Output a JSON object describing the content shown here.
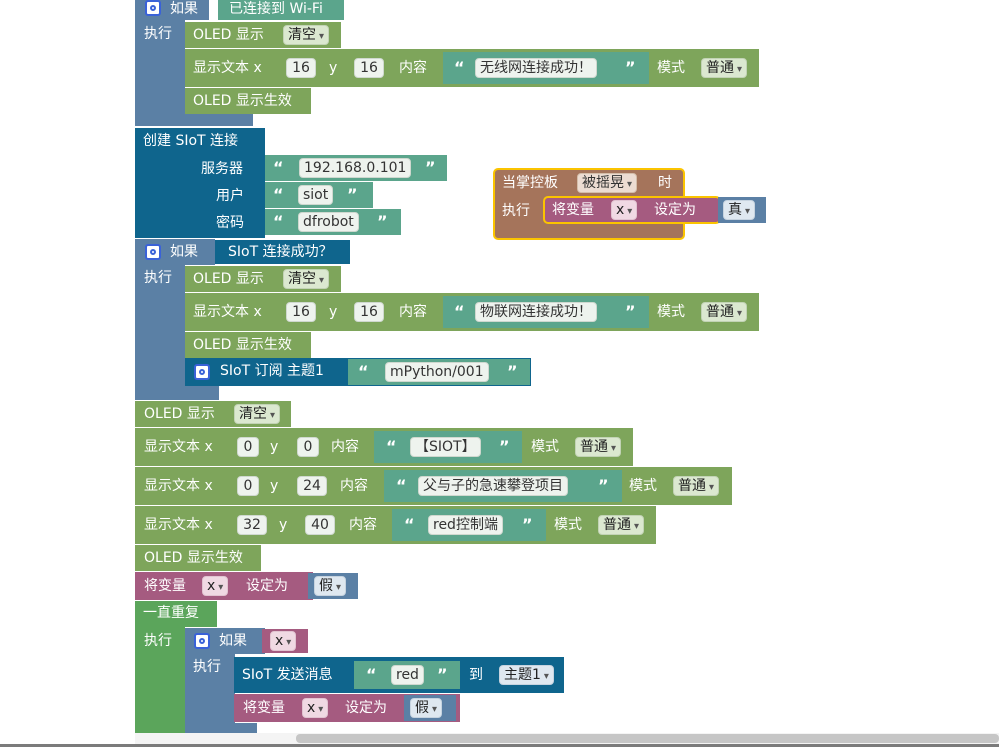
{
  "colors": {
    "logic_blue": "#5b80a5",
    "oled_green": "#7ea55b",
    "green_dark": "#5ba55b",
    "siot_blue": "#0f658d",
    "variable_pink": "#a55b80",
    "text_green": "#5ba58c",
    "event_brown": "#a5745b",
    "event_outline": "#fbc400"
  },
  "blocks": {
    "if1": {
      "label_if": "如果",
      "cond": "已连接到 Wi-Fi",
      "label_do": "执行"
    },
    "oled_clear1": {
      "label": "OLED 显示",
      "option": "清空"
    },
    "show_text1": {
      "label": "显示文本 x",
      "x": "16",
      "y_label": "y",
      "y": "16",
      "content_label": "内容",
      "text": "无线网连接成功！",
      "mode_label": "模式",
      "mode": "普通"
    },
    "oled_apply1": {
      "label": "OLED 显示生效"
    },
    "siot_connect": {
      "label": "创建 SIoT 连接",
      "server_label": "服务器",
      "server": "192.168.0.101",
      "user_label": "用户",
      "user": "siot",
      "pwd_label": "密码",
      "pwd": "dfrobot"
    },
    "shake_event": {
      "label_when": "当掌控板",
      "option": "被摇晃",
      "label_time": "时",
      "label_do": "执行",
      "set_label": "将变量",
      "var": "x",
      "set_to": "设定为",
      "value": "真"
    },
    "if2": {
      "label_if": "如果",
      "cond": "SIoT 连接成功？",
      "label_do": "执行"
    },
    "oled_clear2": {
      "label": "OLED 显示",
      "option": "清空"
    },
    "show_text2": {
      "label": "显示文本 x",
      "x": "16",
      "y_label": "y",
      "y": "16",
      "content_label": "内容",
      "text": "物联网连接成功！",
      "mode_label": "模式",
      "mode": "普通"
    },
    "oled_apply2": {
      "label": "OLED 显示生效"
    },
    "siot_subscribe": {
      "label": "SIoT 订阅 主题1",
      "topic": "mPython/001"
    },
    "oled_clear3": {
      "label": "OLED 显示",
      "option": "清空"
    },
    "show_text3": {
      "label": "显示文本 x",
      "x": "0",
      "y_label": "y",
      "y": "0",
      "content_label": "内容",
      "text": "【SIOT】",
      "mode_label": "模式",
      "mode": "普通"
    },
    "show_text4": {
      "label": "显示文本 x",
      "x": "0",
      "y_label": "y",
      "y": "24",
      "content_label": "内容",
      "text": "父与子的急速攀登项目",
      "mode_label": "模式",
      "mode": "普通"
    },
    "show_text5": {
      "label": "显示文本 x",
      "x": "32",
      "y_label": "y",
      "y": "40",
      "content_label": "内容",
      "text": "red控制端",
      "mode_label": "模式",
      "mode": "普通"
    },
    "oled_apply3": {
      "label": "OLED 显示生效"
    },
    "set_var1": {
      "set_label": "将变量",
      "var": "x",
      "set_to": "设定为",
      "value": "假"
    },
    "forever": {
      "label": "一直重复",
      "label_do": "执行"
    },
    "if3": {
      "label_if": "如果",
      "var": "x",
      "label_do": "执行"
    },
    "siot_send": {
      "label": "SIoT 发送消息",
      "msg": "red",
      "to_label": "到",
      "topic": "主题1"
    },
    "set_var2": {
      "set_label": "将变量",
      "var": "x",
      "set_to": "设定为",
      "value": "假"
    }
  },
  "icons": {
    "gear": "gear-icon",
    "quote_open": "“",
    "quote_close": "”"
  }
}
